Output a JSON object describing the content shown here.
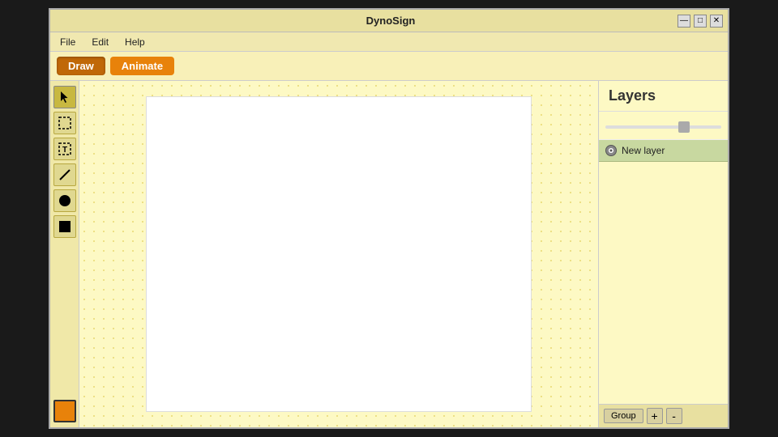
{
  "window": {
    "title": "DynoSign",
    "controls": {
      "minimize": "—",
      "restore": "□",
      "close": "✕"
    }
  },
  "menu": {
    "items": [
      "File",
      "Edit",
      "Help"
    ]
  },
  "toolbar": {
    "draw_label": "Draw",
    "animate_label": "Animate"
  },
  "tools": [
    {
      "id": "select",
      "label": "cursor"
    },
    {
      "id": "rect-select",
      "label": "rect-select"
    },
    {
      "id": "text",
      "label": "text"
    },
    {
      "id": "line",
      "label": "line"
    },
    {
      "id": "circle",
      "label": "circle"
    },
    {
      "id": "square",
      "label": "square"
    }
  ],
  "layers": {
    "title": "Layers",
    "items": [
      {
        "name": "New layer",
        "visible": true
      }
    ],
    "buttons": {
      "group": "Group",
      "add": "+",
      "remove": "-"
    }
  },
  "colors": {
    "accent": "#e8820a",
    "layer_bg": "#c8d8a0",
    "panel_bg": "#fdf9c4"
  }
}
